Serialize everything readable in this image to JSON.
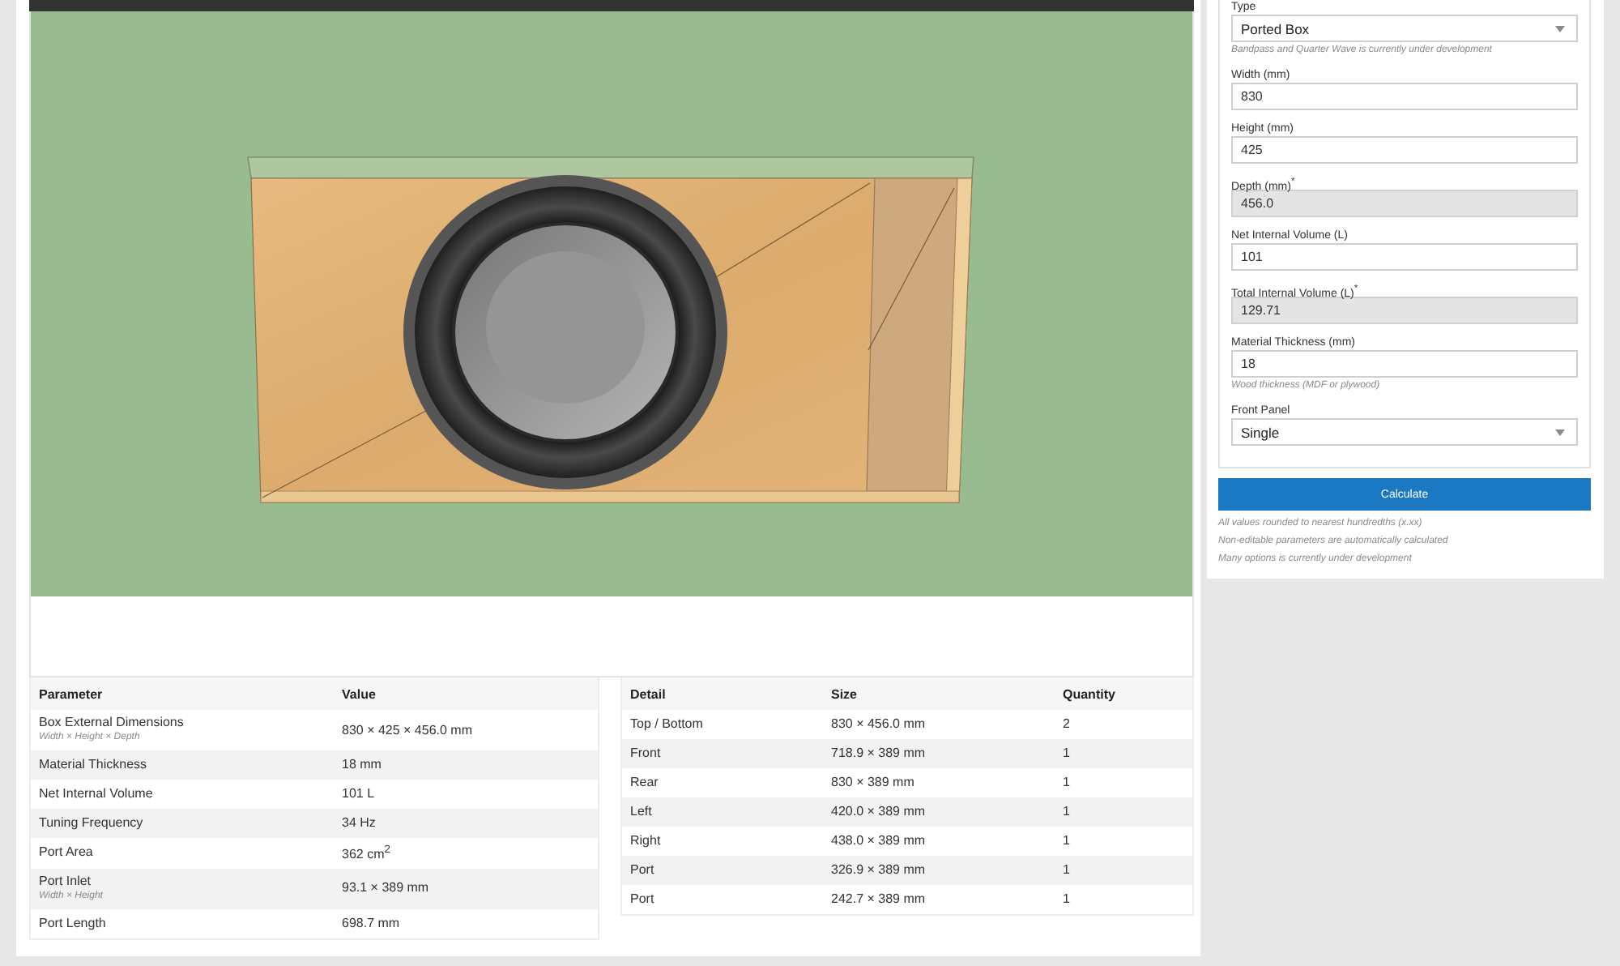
{
  "form": {
    "fields": [
      {
        "kind": "select",
        "label": "Type",
        "value": "Ported Box",
        "hint": "Bandpass and Quarter Wave is currently under development",
        "disabled": false
      },
      {
        "kind": "input",
        "label": "Width (mm)",
        "value": "830",
        "disabled": false
      },
      {
        "kind": "input",
        "label": "Height (mm)",
        "value": "425",
        "disabled": false
      },
      {
        "kind": "input",
        "label": "Depth (mm)$^{*}$",
        "value": "456.0",
        "disabled": true
      },
      {
        "kind": "input",
        "label": "Net Internal Volume (L)",
        "value": "101",
        "disabled": false
      },
      {
        "kind": "input",
        "label": "Total Internal Volume (L)$^{*}$",
        "value": "129.71",
        "disabled": true
      },
      {
        "kind": "input",
        "label": "Material Thickness (mm)",
        "value": "18",
        "hint": "Wood thickness (MDF or plywood)",
        "disabled": false
      },
      {
        "kind": "select",
        "label": "Front Panel",
        "value": "Single",
        "disabled": false
      }
    ],
    "button": "Calculate",
    "notes": [
      "All values rounded to nearest hundredths (x.xx)",
      "Non-editable parameters are automatically calculated",
      "Many options is currently under development"
    ]
  },
  "results_table": {
    "columns": [
      "Parameter",
      "Value"
    ],
    "rows": [
      {
        "parameter": "Box External Dimensions",
        "note": "Width × Height × Depth",
        "value": "830 × 425 × 456.0 mm"
      },
      {
        "parameter": "Material Thickness",
        "value": "18 mm"
      },
      {
        "parameter": "Net Internal Volume",
        "value": "101 L"
      },
      {
        "parameter": "Tuning Frequency",
        "value": "34 Hz"
      },
      {
        "parameter": "Port Area",
        "value": "362 cm$^{2}$"
      },
      {
        "parameter": "Port Inlet",
        "note": "Width × Height",
        "value": "93.1 × 389 mm"
      },
      {
        "parameter": "Port Length",
        "value": "698.7 mm"
      }
    ]
  },
  "cut_list": {
    "columns": [
      "Detail",
      "Size",
      "Quantity"
    ],
    "rows": [
      {
        "detail": "Top / Bottom",
        "size": "830 × 456.0 mm",
        "quantity": "2"
      },
      {
        "detail": "Front",
        "size": "718.9 × 389 mm",
        "quantity": "1"
      },
      {
        "detail": "Rear",
        "size": "830 × 389 mm",
        "quantity": "1"
      },
      {
        "detail": "Left",
        "size": "420.0 × 389 mm",
        "quantity": "1"
      },
      {
        "detail": "Right",
        "size": "438.0 × 389 mm",
        "quantity": "1"
      },
      {
        "detail": "Port",
        "size": "326.9 × 389 mm",
        "quantity": "1"
      },
      {
        "detail": "Port",
        "size": "242.7 × 389 mm",
        "quantity": "1"
      }
    ]
  }
}
